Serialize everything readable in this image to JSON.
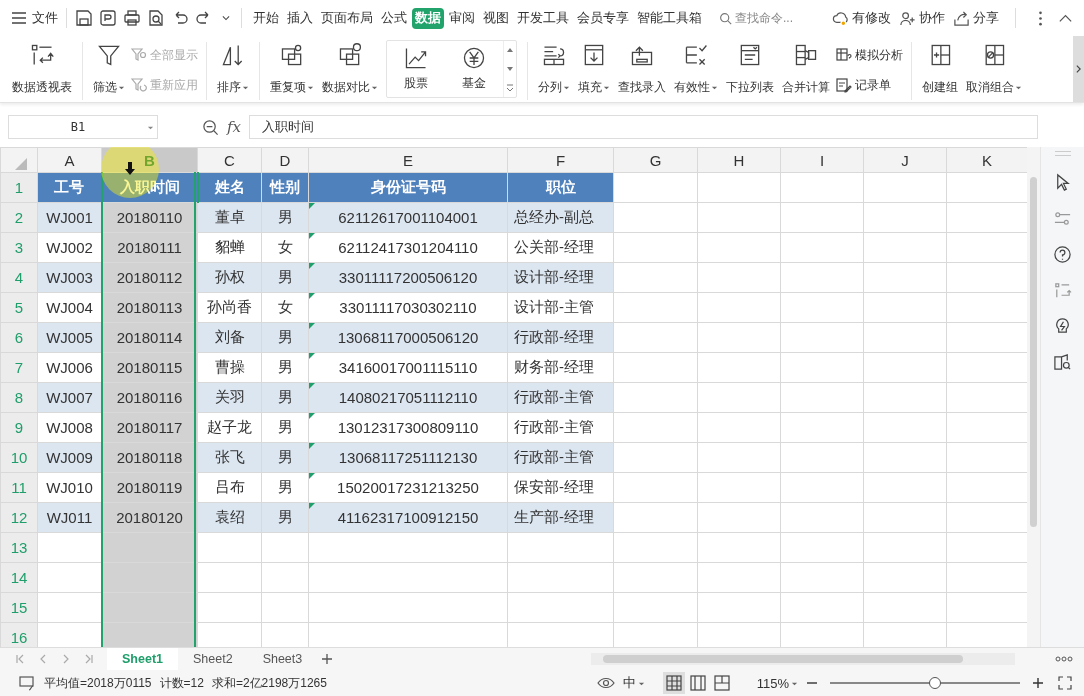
{
  "menu": {
    "file_label": "文件"
  },
  "ribbon_tabs": [
    {
      "label": "开始",
      "selected": false
    },
    {
      "label": "插入",
      "selected": false
    },
    {
      "label": "页面布局",
      "selected": false
    },
    {
      "label": "公式",
      "selected": false
    },
    {
      "label": "数据",
      "selected": true
    },
    {
      "label": "审阅",
      "selected": false
    },
    {
      "label": "视图",
      "selected": false
    },
    {
      "label": "开发工具",
      "selected": false
    },
    {
      "label": "会员专享",
      "selected": false
    },
    {
      "label": "智能工具箱",
      "selected": false
    }
  ],
  "command_search": {
    "placeholder": "查找命令..."
  },
  "top_actions": [
    {
      "label": "有修改"
    },
    {
      "label": "协作"
    },
    {
      "label": "分享"
    }
  ],
  "ribbon_groups": [
    [
      {
        "kind": "large",
        "label": "数据透视表",
        "dropdown": false
      }
    ],
    [
      {
        "kind": "large",
        "label": "筛选",
        "dropdown": true
      },
      {
        "kind": "pair",
        "items": [
          {
            "label": "全部显示",
            "disabled": true
          },
          {
            "label": "重新应用",
            "disabled": true
          }
        ]
      }
    ],
    [
      {
        "kind": "large",
        "label": "排序",
        "dropdown": true
      }
    ],
    [
      {
        "kind": "large",
        "label": "重复项",
        "dropdown": true
      },
      {
        "kind": "large",
        "label": "数据对比",
        "dropdown": true
      },
      {
        "kind": "gallery",
        "items": [
          {
            "label": "股票"
          },
          {
            "label": "基金"
          }
        ]
      }
    ],
    [
      {
        "kind": "large",
        "label": "分列",
        "dropdown": true
      },
      {
        "kind": "large",
        "label": "填充",
        "dropdown": true
      },
      {
        "kind": "large",
        "label": "查找录入",
        "dropdown": false
      },
      {
        "kind": "large",
        "label": "有效性",
        "dropdown": true
      },
      {
        "kind": "large",
        "label": "下拉列表",
        "dropdown": false
      },
      {
        "kind": "large",
        "label": "合并计算",
        "dropdown": false
      },
      {
        "kind": "pair",
        "items": [
          {
            "label": "模拟分析",
            "disabled": false
          },
          {
            "label": "记录单",
            "disabled": false
          }
        ]
      }
    ],
    [
      {
        "kind": "large",
        "label": "创建组",
        "dropdown": false
      },
      {
        "kind": "large",
        "label": "取消组合",
        "dropdown": true
      }
    ]
  ],
  "formula_bar": {
    "name_box": "B1",
    "fx": "fx",
    "value": "入职时间"
  },
  "columns": [
    {
      "letter": "A",
      "selected": false
    },
    {
      "letter": "B",
      "selected": true
    },
    {
      "letter": "C",
      "selected": false
    },
    {
      "letter": "D",
      "selected": false
    },
    {
      "letter": "E",
      "selected": false
    },
    {
      "letter": "F",
      "selected": false
    },
    {
      "letter": "G",
      "selected": false
    },
    {
      "letter": "H",
      "selected": false
    },
    {
      "letter": "I",
      "selected": false
    },
    {
      "letter": "J",
      "selected": false
    },
    {
      "letter": "K",
      "selected": false
    }
  ],
  "row_numbers": [
    "1",
    "2",
    "3",
    "4",
    "5",
    "6",
    "7",
    "8",
    "9",
    "10",
    "11",
    "12",
    "13",
    "14",
    "15",
    "16"
  ],
  "table": {
    "header": [
      "工号",
      "入职时间",
      "姓名",
      "性别",
      "身份证号码",
      "职位"
    ],
    "rows": [
      {
        "cells": [
          "WJ001",
          "20180110",
          "董卓",
          "男",
          "62112617001104001",
          "总经办-副总"
        ],
        "warning": true
      },
      {
        "cells": [
          "WJ002",
          "20180111",
          "貂蝉",
          "女",
          "62112417301204110",
          "公关部-经理"
        ],
        "warning": true
      },
      {
        "cells": [
          "WJ003",
          "20180112",
          "孙权",
          "男",
          "33011117200506120",
          "设计部-经理"
        ],
        "warning": true
      },
      {
        "cells": [
          "WJ004",
          "20180113",
          "孙尚香",
          "女",
          "33011117030302110",
          "设计部-主管"
        ],
        "warning": true
      },
      {
        "cells": [
          "WJ005",
          "20180114",
          "刘备",
          "男",
          "13068117000506120",
          "行政部-经理"
        ],
        "warning": true
      },
      {
        "cells": [
          "WJ006",
          "20180115",
          "曹操",
          "男",
          "34160017001115110",
          "财务部-经理"
        ],
        "warning": true
      },
      {
        "cells": [
          "WJ007",
          "20180116",
          "关羽",
          "男",
          "14080217051112110",
          "行政部-主管"
        ],
        "warning": true
      },
      {
        "cells": [
          "WJ008",
          "20180117",
          "赵子龙",
          "男",
          "13012317300809110",
          "行政部-主管"
        ],
        "warning": true
      },
      {
        "cells": [
          "WJ009",
          "20180118",
          "张飞",
          "男",
          "13068117251112130",
          "行政部-主管"
        ],
        "warning": true
      },
      {
        "cells": [
          "WJ010",
          "20180119",
          "吕布",
          "男",
          "15020017231213250",
          "保安部-经理"
        ],
        "warning": true
      },
      {
        "cells": [
          "WJ011",
          "20180120",
          "袁绍",
          "男",
          "41162317100912150",
          "生产部-经理"
        ],
        "warning": true
      }
    ]
  },
  "sheet_tabs": [
    {
      "label": "Sheet1",
      "selected": true
    },
    {
      "label": "Sheet2",
      "selected": false
    },
    {
      "label": "Sheet3",
      "selected": false
    }
  ],
  "status_bar": {
    "stats": [
      "平均值=2018万0115",
      "计数=12",
      "求和=2亿2198万1265"
    ],
    "input_mode": "中",
    "views": [
      {
        "selected": true
      },
      {
        "selected": false
      },
      {
        "selected": false
      }
    ],
    "zoom": "115%",
    "zoom_slider": {
      "level": 0.55
    }
  }
}
